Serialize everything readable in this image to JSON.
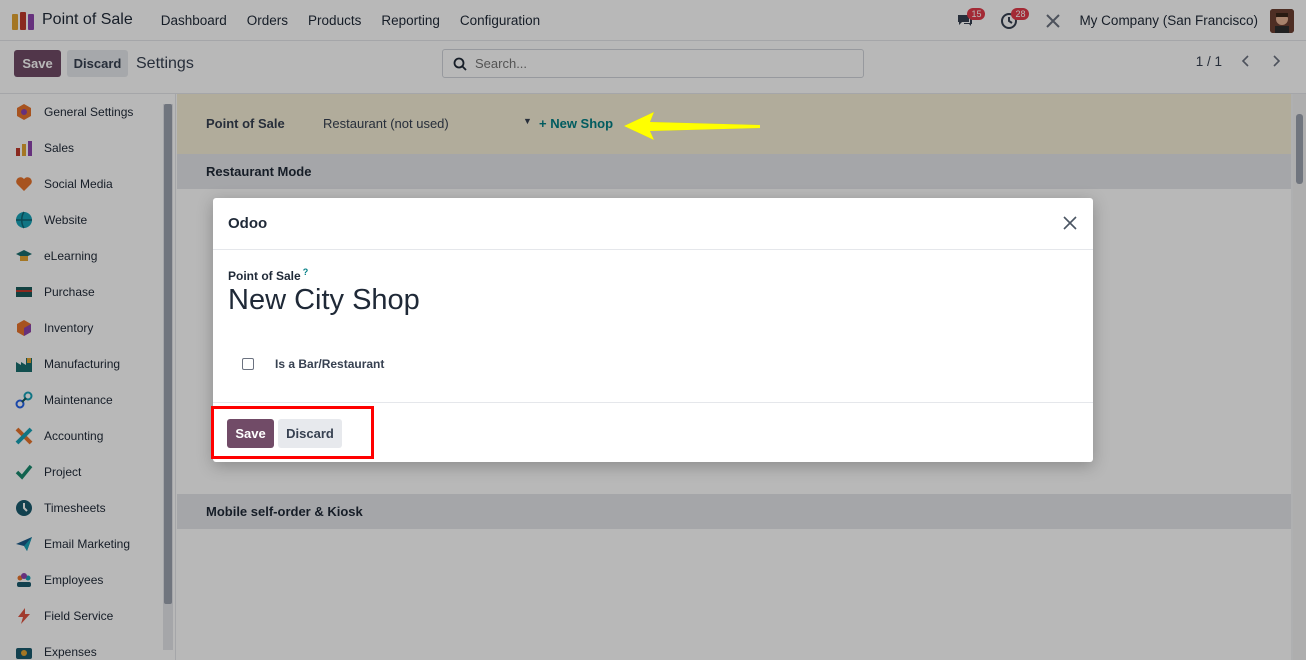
{
  "navbar": {
    "app_name": "Point of Sale",
    "menu": [
      "Dashboard",
      "Orders",
      "Products",
      "Reporting",
      "Configuration"
    ],
    "messages_badge": "15",
    "activities_badge": "28",
    "company": "My Company (San Francisco)"
  },
  "control_panel": {
    "save_label": "Save",
    "discard_label": "Discard",
    "title": "Settings",
    "search_placeholder": "Search...",
    "pager": "1 / 1"
  },
  "sidebar": {
    "items": [
      {
        "label": "General Settings",
        "icon": "general-settings-icon"
      },
      {
        "label": "Sales",
        "icon": "sales-icon"
      },
      {
        "label": "Social Media",
        "icon": "social-media-icon"
      },
      {
        "label": "Website",
        "icon": "website-icon"
      },
      {
        "label": "eLearning",
        "icon": "elearning-icon"
      },
      {
        "label": "Purchase",
        "icon": "purchase-icon"
      },
      {
        "label": "Inventory",
        "icon": "inventory-icon"
      },
      {
        "label": "Manufacturing",
        "icon": "manufacturing-icon"
      },
      {
        "label": "Maintenance",
        "icon": "maintenance-icon"
      },
      {
        "label": "Accounting",
        "icon": "accounting-icon"
      },
      {
        "label": "Project",
        "icon": "project-icon"
      },
      {
        "label": "Timesheets",
        "icon": "timesheets-icon"
      },
      {
        "label": "Email Marketing",
        "icon": "email-marketing-icon"
      },
      {
        "label": "Employees",
        "icon": "employees-icon"
      },
      {
        "label": "Field Service",
        "icon": "field-service-icon"
      },
      {
        "label": "Expenses",
        "icon": "expenses-icon"
      }
    ]
  },
  "settings": {
    "pos_label": "Point of Sale",
    "pos_selected": "Restaurant (not used)",
    "new_shop_label": "+ New Shop",
    "section_restaurant": "Restaurant Mode",
    "section_mobile": "Mobile self-order & Kiosk"
  },
  "modal": {
    "title": "Odoo",
    "field_label": "Point of Sale",
    "help_mark": "?",
    "name_value": "New City Shop",
    "checkbox_label": "Is a Bar/Restaurant",
    "save_label": "Save",
    "discard_label": "Discard"
  },
  "colors": {
    "primary": "#714b67",
    "link": "#017e84",
    "highlight_bar": "#f6efd7",
    "annotation_arrow": "#ffff00",
    "annotation_box": "#ff0000"
  }
}
